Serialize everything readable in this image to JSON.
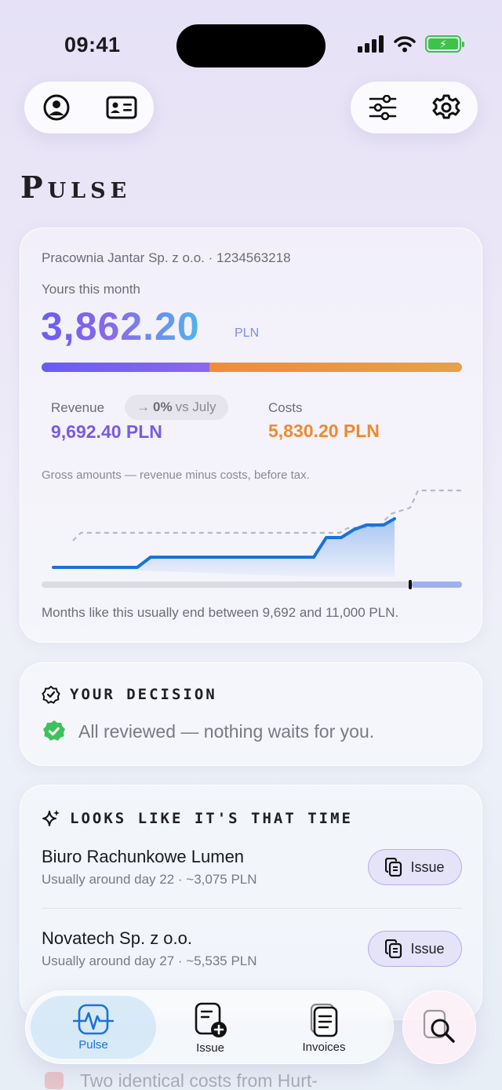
{
  "status_bar": {
    "time": "09:41"
  },
  "page": {
    "title": "Pulse"
  },
  "pulse_card": {
    "company": "Pracownia Jantar Sp. z o.o. · 1234563218",
    "month_label": "Yours this month",
    "amount": "3,862.20",
    "currency": "PLN",
    "revenue_share": 0.4,
    "revenue": {
      "label": "Revenue",
      "value": "9,692.40 PLN"
    },
    "change_chip": {
      "arrow": "→",
      "percent": "0%",
      "suffix": "vs July"
    },
    "costs": {
      "label": "Costs",
      "value": "5,830.20 PLN"
    },
    "gross_note": "Gross amounts — revenue minus costs, before tax.",
    "forecast_note": "Months like this usually end between 9,692 and 11,000 PLN.",
    "colors": {
      "revenue": "#7b5ae6",
      "costs": "#ee8a2f",
      "line": "#1a73d8"
    }
  },
  "decision_card": {
    "title": "YOUR DECISION",
    "status_text": "All reviewed — nothing waits for you."
  },
  "time_card": {
    "title": "LOOKS LIKE IT'S THAT TIME",
    "items": [
      {
        "name": "Biuro Rachunkowe Lumen",
        "detail": "Usually around day 22 · ~3,075 PLN",
        "action": "Issue"
      },
      {
        "name": "Novatech Sp. z o.o.",
        "detail": "Usually around day 27 · ~5,535 PLN",
        "action": "Issue"
      }
    ]
  },
  "peek": {
    "text": "Two identical costs from Hurt-"
  },
  "tabbar": {
    "tabs": [
      {
        "label": "Pulse",
        "icon": "pulse-icon",
        "active": true
      },
      {
        "label": "Issue",
        "icon": "new-document-icon",
        "active": false
      },
      {
        "label": "Invoices",
        "icon": "documents-icon",
        "active": false
      }
    ],
    "search_icon": "document-search-icon"
  }
}
